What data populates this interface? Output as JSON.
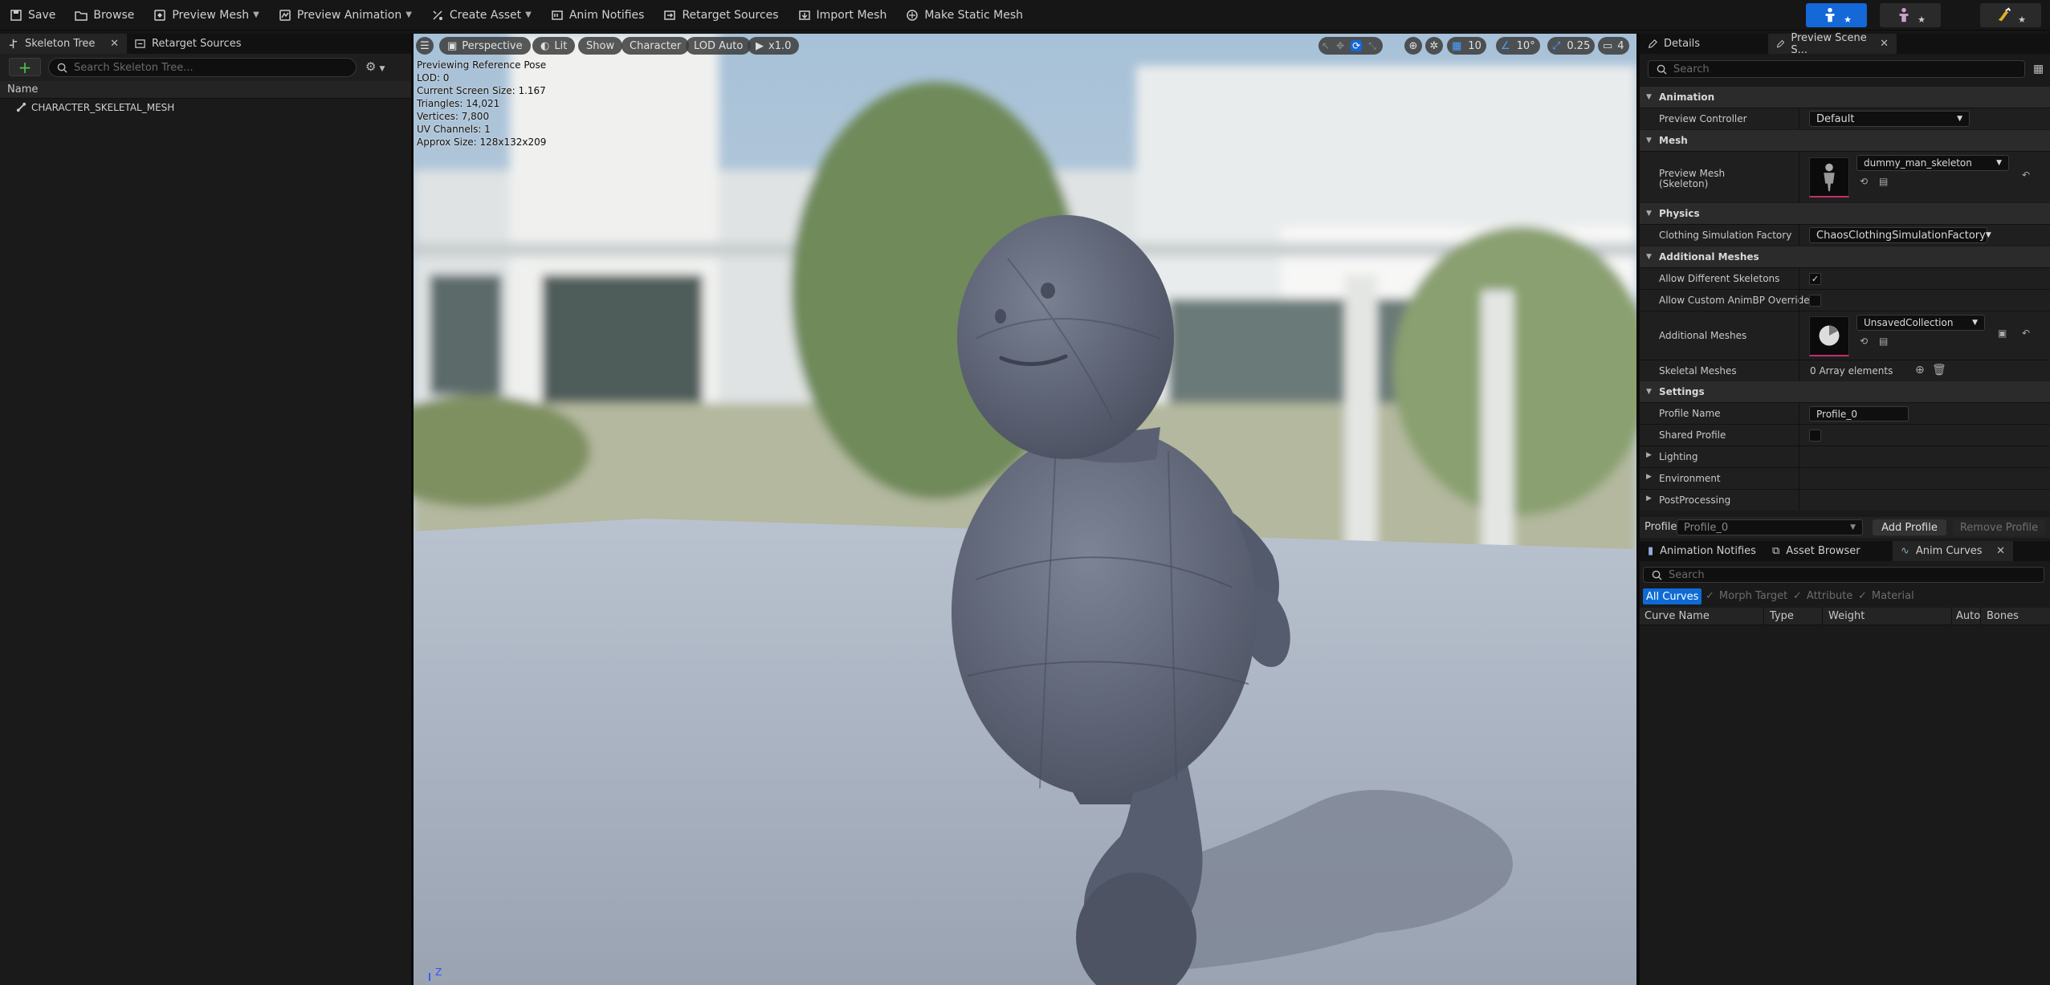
{
  "toolbar": {
    "save": "Save",
    "browse": "Browse",
    "preview_mesh": "Preview Mesh",
    "preview_animation": "Preview Animation",
    "create_asset": "Create Asset",
    "anim_notifies": "Anim Notifies",
    "retarget_sources": "Retarget Sources",
    "import_mesh": "Import Mesh",
    "make_static_mesh": "Make Static Mesh"
  },
  "left_panel": {
    "tab_skeleton_tree": "Skeleton Tree",
    "tab_retarget_sources": "Retarget Sources",
    "search_placeholder": "Search Skeleton Tree...",
    "column_name": "Name",
    "root_bone": "CHARACTER_SKELETAL_MESH"
  },
  "viewport": {
    "perspective": "Perspective",
    "lit": "Lit",
    "show": "Show",
    "character": "Character",
    "lod": "LOD Auto",
    "play_speed": "x1.0",
    "grid_snap": "10",
    "rotation_snap": "10°",
    "scale_snap": "0.25",
    "camera_speed": "4",
    "stats": [
      "Previewing Reference Pose",
      "LOD: 0",
      "Current Screen Size: 1.167",
      "Triangles: 14,021",
      "Vertices: 7,800",
      "UV Channels: 1",
      "Approx Size: 128x132x209"
    ],
    "axis_label": "Z"
  },
  "details": {
    "tab_details": "Details",
    "tab_preview_scene": "Preview Scene S...",
    "search_placeholder": "Search",
    "categories": {
      "animation": "Animation",
      "mesh": "Mesh",
      "physics": "Physics",
      "additional_meshes": "Additional Meshes",
      "settings": "Settings"
    },
    "preview_controller_label": "Preview Controller",
    "preview_controller_value": "Default",
    "preview_mesh_label_1": "Preview Mesh",
    "preview_mesh_label_2": "(Skeleton)",
    "preview_mesh_value": "dummy_man_skeleton",
    "clothing_label": "Clothing Simulation Factory",
    "clothing_value": "ChaosClothingSimulationFactory",
    "allow_diff_skeletons": "Allow Different Skeletons",
    "allow_diff_skeletons_checked": true,
    "allow_custom_animbp": "Allow Custom AnimBP Override",
    "additional_meshes_label": "Additional Meshes",
    "additional_meshes_value": "UnsavedCollection",
    "skeletal_meshes_label": "Skeletal Meshes",
    "skeletal_meshes_value": "0 Array elements",
    "profile_name_label": "Profile Name",
    "profile_name_value": "Profile_0",
    "shared_profile_label": "Shared Profile",
    "lighting": "Lighting",
    "environment": "Environment",
    "post_processing": "PostProcessing",
    "profile_label": "Profile",
    "profile_value": "Profile_0",
    "add_profile": "Add Profile",
    "remove_profile": "Remove Profile"
  },
  "bottom_panel": {
    "tab_anim_notifies": "Animation Notifies",
    "tab_asset_browser": "Asset Browser",
    "tab_anim_curves": "Anim Curves",
    "search_placeholder": "Search",
    "filter_all": "All Curves",
    "filter_morph": "Morph Target",
    "filter_attribute": "Attribute",
    "filter_material": "Material",
    "columns": [
      "Curve Name",
      "Type",
      "Weight",
      "Auto",
      "Bones"
    ]
  },
  "colors": {
    "accent_blue": "#0e6bd6",
    "mode_active": "#1468d8",
    "mode_inactive": "#2a2a2a",
    "underline_pink": "#c0306b"
  }
}
